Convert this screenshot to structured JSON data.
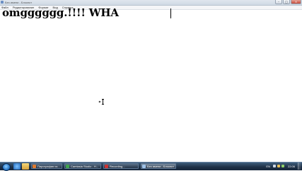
{
  "window": {
    "title": "Без  имени - Блокнот",
    "controls": {
      "minimize": "–",
      "maximize": "□",
      "close": "×"
    }
  },
  "menu": {
    "items": [
      "Файл",
      "Редактирование",
      "Формат",
      "Вид",
      "Справка"
    ]
  },
  "editor": {
    "content": "omgggggg.!!!! WHA"
  },
  "taskbar": {
    "tasks": [
      {
        "label": "Пирография из..."
      },
      {
        "label": "Camtasia Studio - Н..."
      },
      {
        "label": "Recording..."
      },
      {
        "label": "Без имени - Блокнот"
      }
    ],
    "language": "EN",
    "clock": "22:06"
  },
  "colors": {
    "taskbar": "#1d2f45",
    "accent": "#2a78c8",
    "close_button": "#c2493a"
  },
  "icons": [
    "notepad-icon",
    "windows-start-icon",
    "ie-icon",
    "folder-icon",
    "media-player-icon",
    "mouse-cursor-icon"
  ]
}
